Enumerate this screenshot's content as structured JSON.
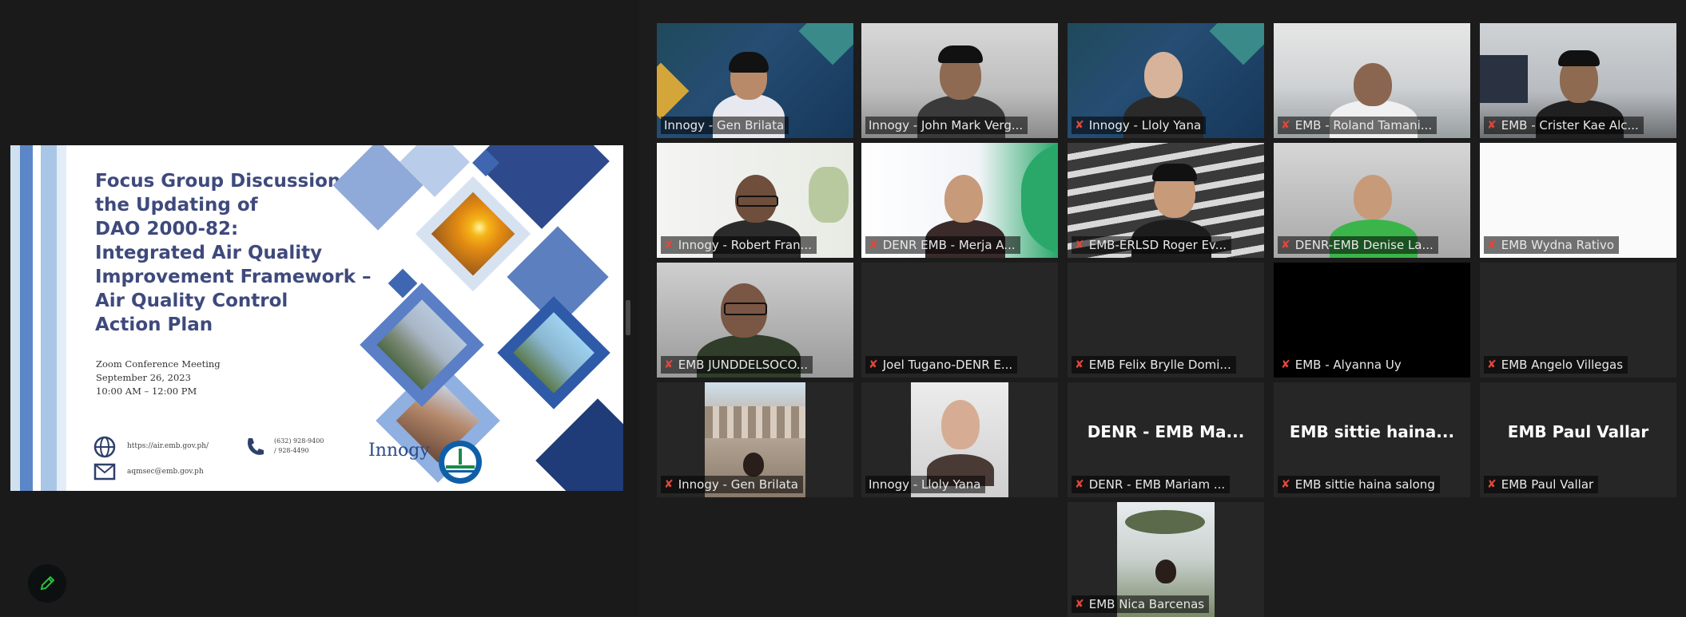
{
  "colors": {
    "background": "#1c1c1c",
    "active_speaker_border": "#c8d855",
    "muted_icon": "#e0473b",
    "slide_title": "#3e4a7c"
  },
  "shared_slide": {
    "title_lines": [
      "Focus Group Discussion for",
      "the Updating of",
      "DAO 2000-82:",
      "Integrated Air Quality",
      "Improvement Framework –",
      "Air Quality Control",
      "Action Plan"
    ],
    "meeting": "Zoom Conference Meeting",
    "date": "September 26, 2023",
    "time": "10:00 AM – 12:00 PM",
    "website": "https://air.emb.gov.ph/",
    "email": "aqmsec@emb.gov.ph",
    "phone_1": "(632) 928-9400",
    "phone_2": "/ 928-4490",
    "logo_text": "Innogy"
  },
  "participants": [
    {
      "name": "Innogy - Gen Brilata",
      "muted": false
    },
    {
      "name": "Innogy - John Mark Verg...",
      "muted": false
    },
    {
      "name": "Innogy - Lloly Yana",
      "muted": true
    },
    {
      "name": "EMB - Roland Tamani...",
      "muted": true
    },
    {
      "name": "EMB - Crister Kae Alc...",
      "muted": true
    },
    {
      "name": "Innogy - Robert Fran...",
      "muted": true
    },
    {
      "name": "DENR EMB - Merja A...",
      "muted": true
    },
    {
      "name": "EMB-ERLSD Roger Ev...",
      "muted": true
    },
    {
      "name": "DENR-EMB Denise La...",
      "muted": true
    },
    {
      "name": "EMB Wydna Rativo",
      "muted": true
    },
    {
      "name": "EMB JUNDDELSOCO...",
      "muted": true
    },
    {
      "name": "Joel Tugano-DENR E...",
      "muted": true
    },
    {
      "name": "EMB Felix Brylle Domi...",
      "muted": true
    },
    {
      "name": "EMB - Alyanna Uy",
      "muted": true
    },
    {
      "name": "EMB Angelo Villegas",
      "muted": true
    },
    {
      "name": "Innogy - Gen Brilata",
      "muted": true
    },
    {
      "name": "Innogy - Lloly Yana",
      "muted": false
    },
    {
      "name": "DENR - EMB Mariam ...",
      "muted": true,
      "display": "DENR - EMB Ma..."
    },
    {
      "name": "EMB sittie haina salong",
      "muted": true,
      "display": "EMB sittie haina..."
    },
    {
      "name": "EMB Paul Vallar",
      "muted": true,
      "display": "EMB Paul Vallar"
    },
    {
      "name": "EMB Nica Barcenas",
      "muted": true
    }
  ],
  "icons": {
    "mic_muted": "muted-mic-icon",
    "edit": "pencil-icon"
  }
}
